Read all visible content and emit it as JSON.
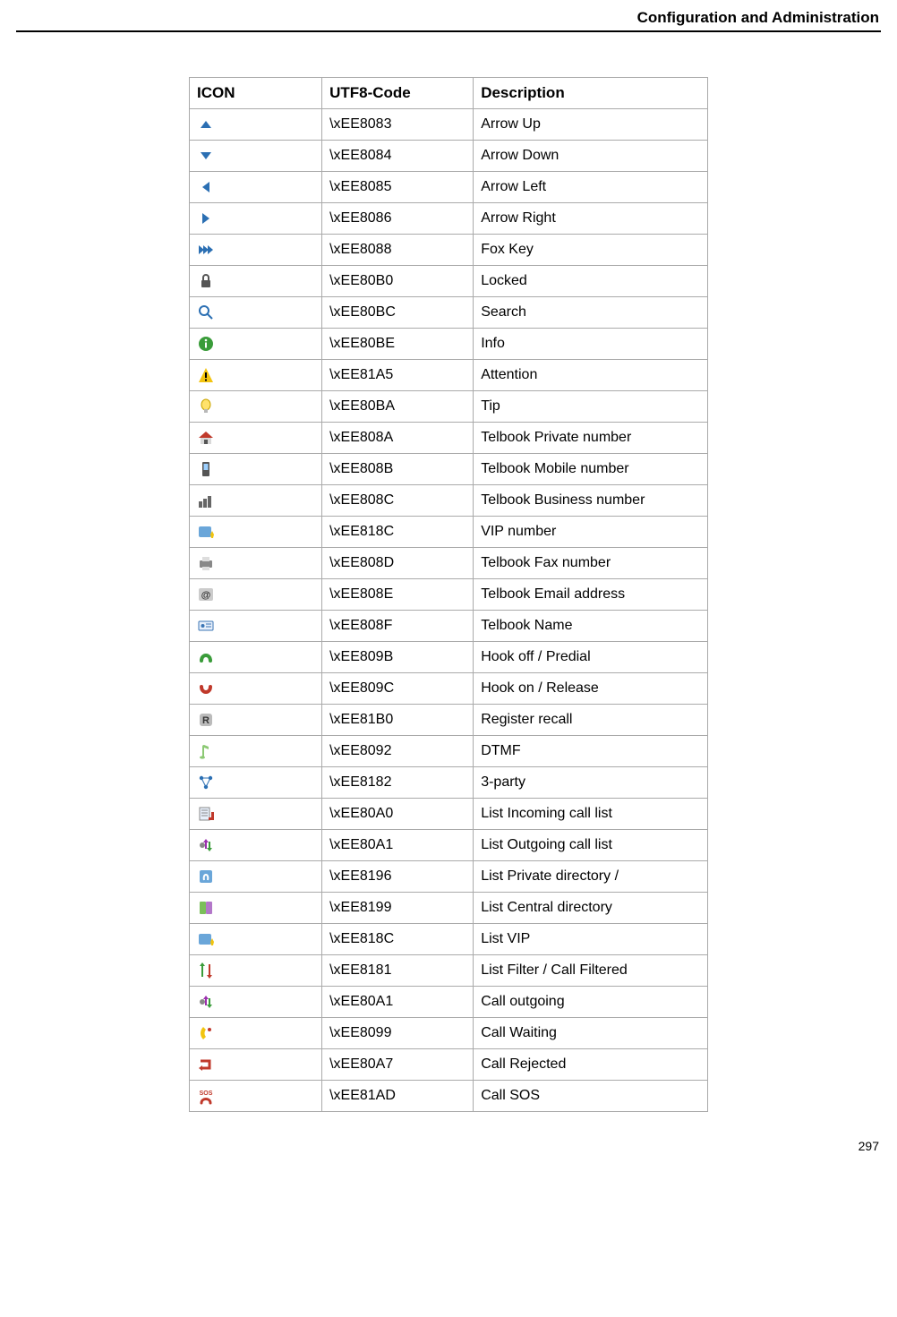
{
  "header": {
    "title": "Configuration and Administration"
  },
  "table": {
    "columns": {
      "icon": "ICON",
      "code": "UTF8-Code",
      "desc": "Description"
    },
    "rows": [
      {
        "icon": "arrow-up-icon",
        "code": "\\xEE8083",
        "desc": "Arrow Up"
      },
      {
        "icon": "arrow-down-icon",
        "code": "\\xEE8084",
        "desc": "Arrow Down"
      },
      {
        "icon": "arrow-left-icon",
        "code": "\\xEE8085",
        "desc": "Arrow Left"
      },
      {
        "icon": "arrow-right-icon",
        "code": "\\xEE8086",
        "desc": "Arrow Right"
      },
      {
        "icon": "fox-key-icon",
        "code": "\\xEE8088",
        "desc": "Fox Key"
      },
      {
        "icon": "locked-icon",
        "code": "\\xEE80B0",
        "desc": "Locked"
      },
      {
        "icon": "search-icon",
        "code": "\\xEE80BC",
        "desc": "Search"
      },
      {
        "icon": "info-icon",
        "code": "\\xEE80BE",
        "desc": "Info"
      },
      {
        "icon": "attention-icon",
        "code": "\\xEE81A5",
        "desc": "Attention"
      },
      {
        "icon": "tip-icon",
        "code": "\\xEE80BA",
        "desc": "Tip"
      },
      {
        "icon": "home-icon",
        "code": "\\xEE808A",
        "desc": "Telbook Private number"
      },
      {
        "icon": "mobile-icon",
        "code": "\\xEE808B",
        "desc": "Telbook Mobile number"
      },
      {
        "icon": "business-icon",
        "code": "\\xEE808C",
        "desc": "Telbook Business number"
      },
      {
        "icon": "vip-icon",
        "code": "\\xEE818C",
        "desc": "VIP number"
      },
      {
        "icon": "fax-icon",
        "code": "\\xEE808D",
        "desc": "Telbook Fax number"
      },
      {
        "icon": "email-icon",
        "code": "\\xEE808E",
        "desc": "Telbook Email address"
      },
      {
        "icon": "name-card-icon",
        "code": "\\xEE808F",
        "desc": "Telbook Name"
      },
      {
        "icon": "hook-off-icon",
        "code": "\\xEE809B",
        "desc": "Hook off / Predial"
      },
      {
        "icon": "hook-on-icon",
        "code": "\\xEE809C",
        "desc": "Hook on / Release"
      },
      {
        "icon": "register-recall-icon",
        "code": "\\xEE81B0",
        "desc": "Register recall"
      },
      {
        "icon": "dtmf-icon",
        "code": "\\xEE8092",
        "desc": "DTMF"
      },
      {
        "icon": "three-party-icon",
        "code": "\\xEE8182",
        "desc": "3-party"
      },
      {
        "icon": "list-incoming-icon",
        "code": "\\xEE80A0",
        "desc": "List Incoming call list"
      },
      {
        "icon": "list-outgoing-icon",
        "code": "\\xEE80A1",
        "desc": "List Outgoing call list"
      },
      {
        "icon": "list-private-icon",
        "code": "\\xEE8196",
        "desc": "List Private directory /"
      },
      {
        "icon": "list-central-icon",
        "code": "\\xEE8199",
        "desc": "List Central directory"
      },
      {
        "icon": "list-vip-icon",
        "code": "\\xEE818C",
        "desc": "List VIP"
      },
      {
        "icon": "list-filter-icon",
        "code": "\\xEE8181",
        "desc": "List Filter / Call Filtered"
      },
      {
        "icon": "call-outgoing-icon",
        "code": "\\xEE80A1",
        "desc": "Call outgoing"
      },
      {
        "icon": "call-waiting-icon",
        "code": "\\xEE8099",
        "desc": "Call Waiting"
      },
      {
        "icon": "call-rejected-icon",
        "code": "\\xEE80A7",
        "desc": "Call Rejected"
      },
      {
        "icon": "call-sos-icon",
        "code": "\\xEE81AD",
        "desc": "Call SOS"
      }
    ]
  },
  "page_number": "297"
}
